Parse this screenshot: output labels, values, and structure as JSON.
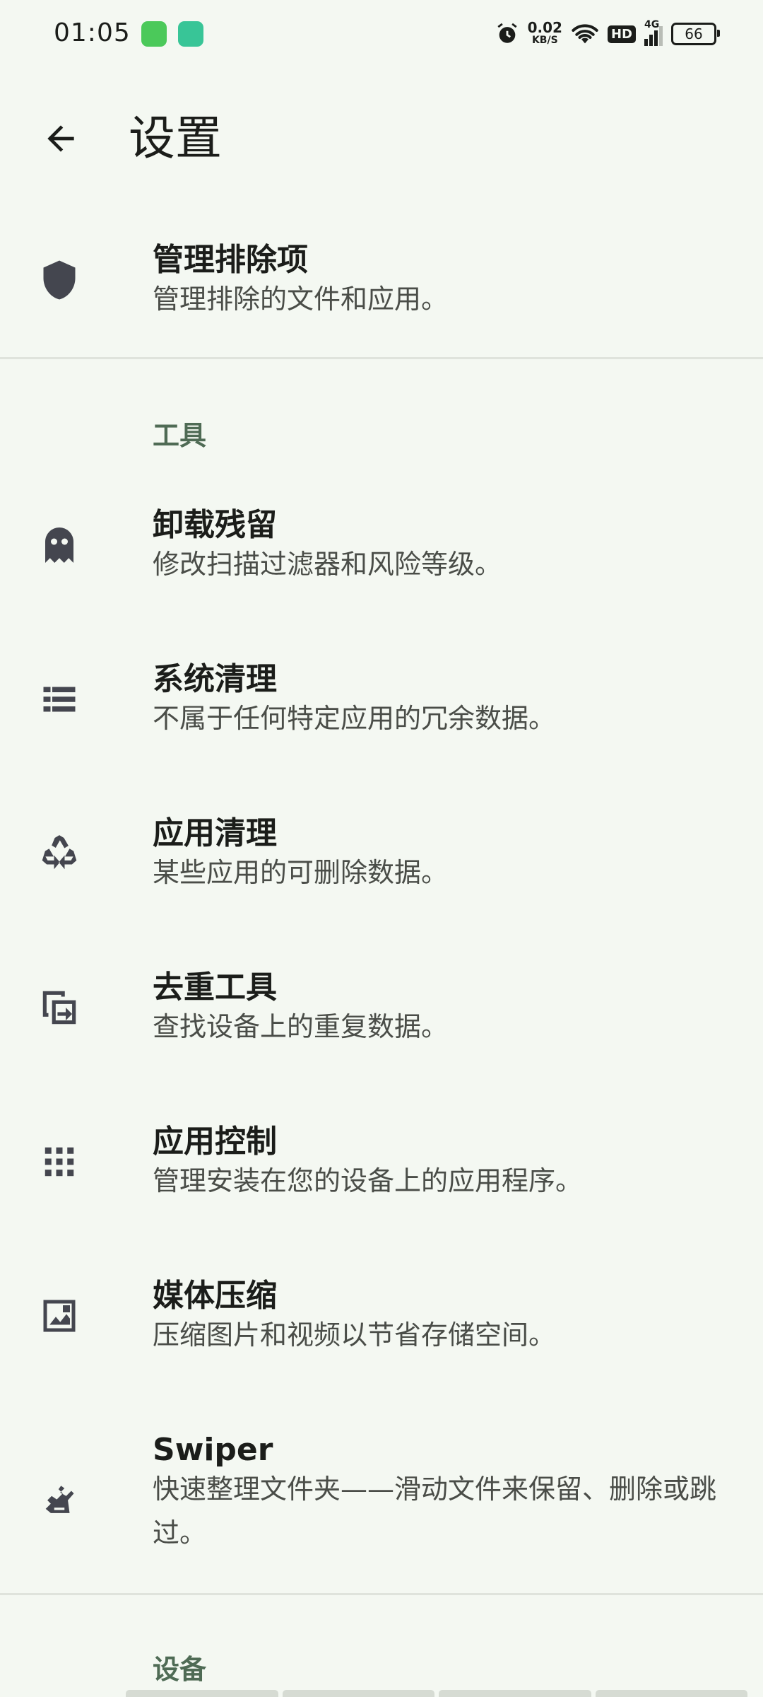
{
  "status_bar": {
    "time": "01:05",
    "net_speed": "0.02",
    "net_unit": "KB/S",
    "hd_label": "HD",
    "signal_label": "4G",
    "battery": "66"
  },
  "app_bar": {
    "title": "设置"
  },
  "exclusions": {
    "title": "管理排除项",
    "subtitle": "管理排除的文件和应用。",
    "icon": "shield-icon"
  },
  "sections": [
    {
      "header": "工具",
      "items": [
        {
          "title": "卸载残留",
          "subtitle": "修改扫描过滤器和风险等级。",
          "icon": "ghost-icon"
        },
        {
          "title": "系统清理",
          "subtitle": "不属于任何特定应用的冗余数据。",
          "icon": "list-icon"
        },
        {
          "title": "应用清理",
          "subtitle": "某些应用的可删除数据。",
          "icon": "recycle-icon"
        },
        {
          "title": "去重工具",
          "subtitle": "查找设备上的重复数据。",
          "icon": "duplicate-icon"
        },
        {
          "title": "应用控制",
          "subtitle": "管理安装在您的设备上的应用程序。",
          "icon": "apps-grid-icon"
        },
        {
          "title": "媒体压缩",
          "subtitle": "压缩图片和视频以节省存储空间。",
          "icon": "image-icon"
        },
        {
          "title": "Swiper",
          "subtitle": "快速整理文件夹——滑动文件来保留、删除或跳过。",
          "icon": "swipe-icon"
        }
      ]
    },
    {
      "header": "设备",
      "items": []
    }
  ],
  "colors": {
    "background": "#f4f8f2",
    "text_primary": "#1b1d1a",
    "text_secondary": "#4a4d48",
    "section_header": "#4f6b55",
    "icon": "#44464f"
  }
}
